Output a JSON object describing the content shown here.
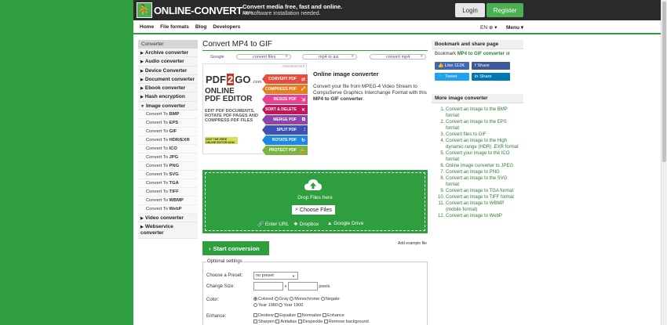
{
  "header": {
    "logo_mark": "⛹",
    "logo_text": "ONLINE-CONVERT",
    "logo_tld": ".com",
    "tagline_1": "Convert media free, fast and online.",
    "tagline_2": "No software installation needed.",
    "login_label": "Login",
    "register_label": "Register"
  },
  "nav": {
    "items": [
      "Home",
      "File formats",
      "Blog",
      "Developers"
    ],
    "lang": "EN ⊕ ▾",
    "menu": "Menu ▾"
  },
  "sidebar": {
    "heading": "Converter",
    "categories_top": [
      "Archive converter",
      "Audio converter",
      "Device Converter",
      "Document converter",
      "Ebook converter",
      "Hash encryption"
    ],
    "open_category": "Image converter",
    "subitems": [
      {
        "prefix": "Convert To ",
        "fmt": "BMP"
      },
      {
        "prefix": "Convert To ",
        "fmt": "EPS"
      },
      {
        "prefix": "Convert To ",
        "fmt": "GIF"
      },
      {
        "prefix": "Convert To ",
        "fmt": "HDR/EXR"
      },
      {
        "prefix": "Convert To ",
        "fmt": "ICO"
      },
      {
        "prefix": "Convert To ",
        "fmt": "JPG"
      },
      {
        "prefix": "Convert To ",
        "fmt": "PNG"
      },
      {
        "prefix": "Convert To ",
        "fmt": "SVG"
      },
      {
        "prefix": "Convert To ",
        "fmt": "TGA"
      },
      {
        "prefix": "Convert To ",
        "fmt": "TIFF"
      },
      {
        "prefix": "Convert To ",
        "fmt": "WBMP"
      },
      {
        "prefix": "Convert To ",
        "fmt": "WebP"
      }
    ],
    "categories_bottom": [
      "Video converter",
      "Webservice converter"
    ]
  },
  "main": {
    "title": "Convert MP4 to GIF",
    "google_label": "Google",
    "search_fields": [
      "convert files",
      "mp4 to avi",
      "convert mp4"
    ],
    "ad": {
      "badge": "Advertisement",
      "logo_a": "PDF",
      "logo_b": "2",
      "logo_c": "GO",
      "logo_d": ".com",
      "headline_1": "ONLINE",
      "headline_2": "PDF EDITOR",
      "desc": "EDIT PDF DOCUMENTS, ROTATE PDF PAGES AND COMPRESS PDF FILES",
      "cta": "VISIT THE FREE ONLINE EDITOR NOW",
      "buttons": [
        {
          "label": "CONVERT PDF",
          "color": "#e74c3c",
          "icon": "⇄"
        },
        {
          "label": "COMPRESS PDF",
          "color": "#e67e22",
          "icon": "⤢"
        },
        {
          "label": "RESIZE PDF",
          "color": "#e84393",
          "icon": "⇲"
        },
        {
          "label": "SORT & DELETE",
          "color": "#c2185b",
          "icon": "✕"
        },
        {
          "label": "MERGE PDF",
          "color": "#8e44ad",
          "icon": "⧉"
        },
        {
          "label": "SPLIT PDF",
          "color": "#3f51b5",
          "icon": "⫶"
        },
        {
          "label": "ROTATE PDF",
          "color": "#1e88e5",
          "icon": "↻"
        },
        {
          "label": "PROTECT PDF",
          "color": "#7cb342",
          "icon": "🔒"
        }
      ]
    },
    "converter_title": "Online image converter",
    "converter_desc_a": "Convert your file from MPEG-4 Video Stream to CompuServe Graphics Interchange Format with this ",
    "converter_desc_b": "MP4 to GIF converter",
    "converter_desc_c": ".",
    "drop_text": "Drop Files here",
    "choose_label": "Choose Files",
    "sources": [
      "Enter URL",
      "Dropbox",
      "Google Drive"
    ],
    "add_example": "Add example file",
    "start_label": "Start conversion",
    "options": {
      "legend": "Optional settings",
      "preset_label": "Choose a Preset:",
      "preset_value": "no preset",
      "size_label": "Change Size:",
      "size_x": "x",
      "size_unit": "pixels",
      "color_label": "Color:",
      "color_opts": [
        "Colored",
        "Gray",
        "Monochrome",
        "Negate",
        "Year 1980",
        "Year 1900"
      ],
      "enhance_label": "Enhance:",
      "enhance_opts": [
        "Deskew",
        "Equalize",
        "Normalize",
        "Enhance",
        "Sharpen",
        "Antialias",
        "Despeckle",
        "Remove background"
      ]
    }
  },
  "right": {
    "bookmark_heading": "Bookmark and share page",
    "bookmark_prefix": "Bookmark ",
    "bookmark_link": "MP4 to GIF converter",
    "bookmark_suffix": " or",
    "like_label": "Like 112K",
    "share_label": "Share",
    "tweet_label": "Tweet",
    "share2_label": "Share",
    "more_heading": "More image converter",
    "links": [
      "Convert an image to the BMP format",
      "Convert an image to the EPS format",
      "Convert files to GIF",
      "Convert an image to the High dynamic-range (HDR) .EXR format",
      "Convert your image to the ICO format",
      "Online image converter to JPEG",
      "Convert an image to PNG",
      "Convert an image to the SVG format",
      "Convert an image to TGA format",
      "Convert an image to TIFF format",
      "Convert an image to WBMP (mobile format)",
      "Convert an image to WebP"
    ]
  }
}
